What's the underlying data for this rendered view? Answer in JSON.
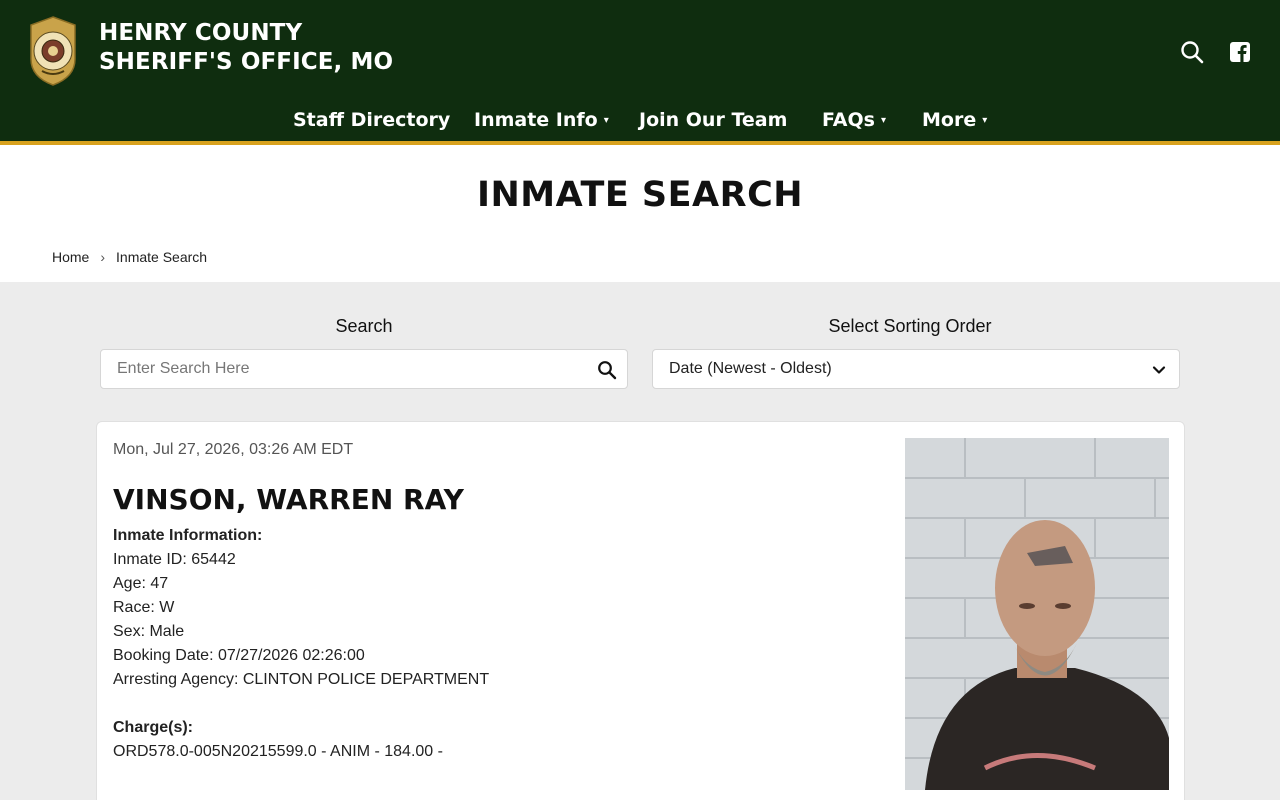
{
  "header": {
    "brand_line1": "HENRY COUNTY",
    "brand_line2": "SHERIFF'S OFFICE, MO",
    "brand_color": "#0f2d0f",
    "accent_color": "#d8a21e",
    "icons": [
      "search-icon",
      "facebook-icon"
    ]
  },
  "nav": {
    "items": [
      {
        "label": "Staff Directory",
        "dropdown": false
      },
      {
        "label": "Inmate Info",
        "dropdown": true
      },
      {
        "label": "Join Our Team",
        "dropdown": false
      },
      {
        "label": "FAQs",
        "dropdown": true
      },
      {
        "label": "More",
        "dropdown": true
      }
    ],
    "caret": "▾"
  },
  "page": {
    "title": "INMATE SEARCH",
    "breadcrumb": {
      "home": "Home",
      "separator": "›",
      "current": "Inmate Search"
    }
  },
  "filters": {
    "search_label": "Search",
    "search_placeholder": "Enter Search Here",
    "search_value": "",
    "sort_label": "Select Sorting Order",
    "sort_value": "Date (Newest - Oldest)"
  },
  "inmate": {
    "date": "Mon, Jul 27, 2026, 03:26 AM EDT",
    "name": "VINSON, WARREN RAY",
    "info_heading": "Inmate Information:",
    "fields": {
      "id": "Inmate ID: 65442",
      "age": "Age: 47",
      "race": "Race: W",
      "sex": "Sex: Male",
      "booking": "Booking Date: 07/27/2026 02:26:00",
      "agency": "Arresting Agency: CLINTON POLICE DEPARTMENT"
    },
    "charges_heading": "Charge(s):",
    "charges": [
      "ORD578.0-005N20215599.0 - ANIM - 184.00 -"
    ]
  }
}
